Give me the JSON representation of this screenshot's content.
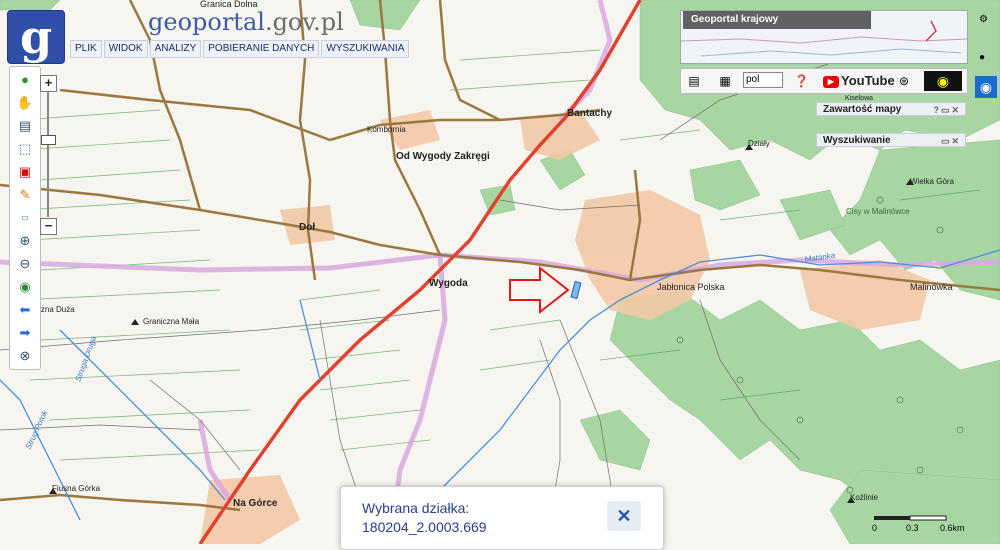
{
  "header": {
    "logo_letter": "g",
    "site_name": "geoportal",
    "site_domain": ".gov.pl",
    "menu": [
      "PLIK",
      "WIDOK",
      "ANALIZY",
      "POBIERANIE DANYCH",
      "WYSZUKIWANIA"
    ]
  },
  "overview": {
    "title": "Geoportal krajowy"
  },
  "iconbar": {
    "language": "pol",
    "youtube": "YouTube"
  },
  "panels": {
    "map_contents": "Zawartość mapy",
    "search": "Wyszukiwanie"
  },
  "place_labels": {
    "granica_dolna": "Granica Dolna",
    "bantachy": "Bantachy",
    "kombornia": "Kombornia",
    "od_wygody": "Od Wygody Zakręgi",
    "dol": "Doł",
    "wygoda": "Wygoda",
    "jablonica": "Jabłonica Polska",
    "malinowka": "Malinówka",
    "wielka_gora": "Wielka Góra",
    "cisy": "Cisy w Malinówce",
    "dzialy": "Działy",
    "kiselowa": "Kiselowa",
    "laczna_duza": "Łączna Duża",
    "graniczna_mala": "Graniczna Mała",
    "fiusna_gorka": "Fiusna Górka",
    "na_gorce": "Na Górce",
    "kozlinie": "Koźlinie",
    "stream1": "Struga Druga",
    "stream2": "Strug Potok",
    "river": "Matanka"
  },
  "popup": {
    "label": "Wybrana działka:",
    "parcel_id": "180204_2.0003.669",
    "close_symbol": "✕"
  },
  "scale": {
    "t0": "0",
    "t1": "0.3",
    "t2": "0.6km"
  },
  "colors": {
    "forest": "#9fcf9e",
    "road_main": "#e0422f",
    "road_minor": "#8a6a3a",
    "water": "#4a8fd8",
    "built": "#f0c8a8",
    "boundary": "#d9a8e0",
    "arrow": "#e01818"
  }
}
